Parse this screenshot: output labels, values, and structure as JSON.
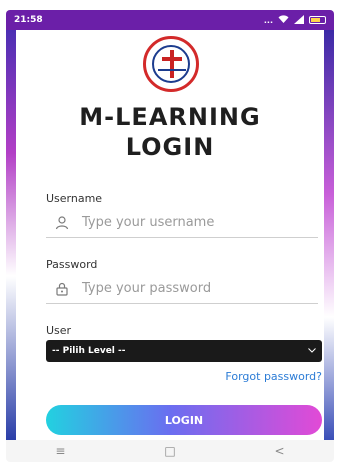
{
  "status_bar": {
    "time": "21:58",
    "signal_text": "..."
  },
  "logo": {
    "alt": "Sekolah Kristen Kalam Kudus Pekanbaru"
  },
  "title": {
    "line1": "M-LEARNING",
    "line2": "LOGIN"
  },
  "form": {
    "username_label": "Username",
    "username_placeholder": "Type your username",
    "password_label": "Password",
    "password_placeholder": "Type your password",
    "user_label": "User",
    "user_select_value": "-- Pilih Level --",
    "forgot_link": "Forgot password?",
    "login_button": "LOGIN"
  },
  "nav": {
    "menu_icon": "≡",
    "home_icon": "□",
    "back_icon": "<"
  },
  "colors": {
    "status_bar": "#6b1fa8",
    "link": "#2c7cd6",
    "button_gradient_start": "#22d1e0",
    "button_gradient_end": "#e24ad6"
  }
}
